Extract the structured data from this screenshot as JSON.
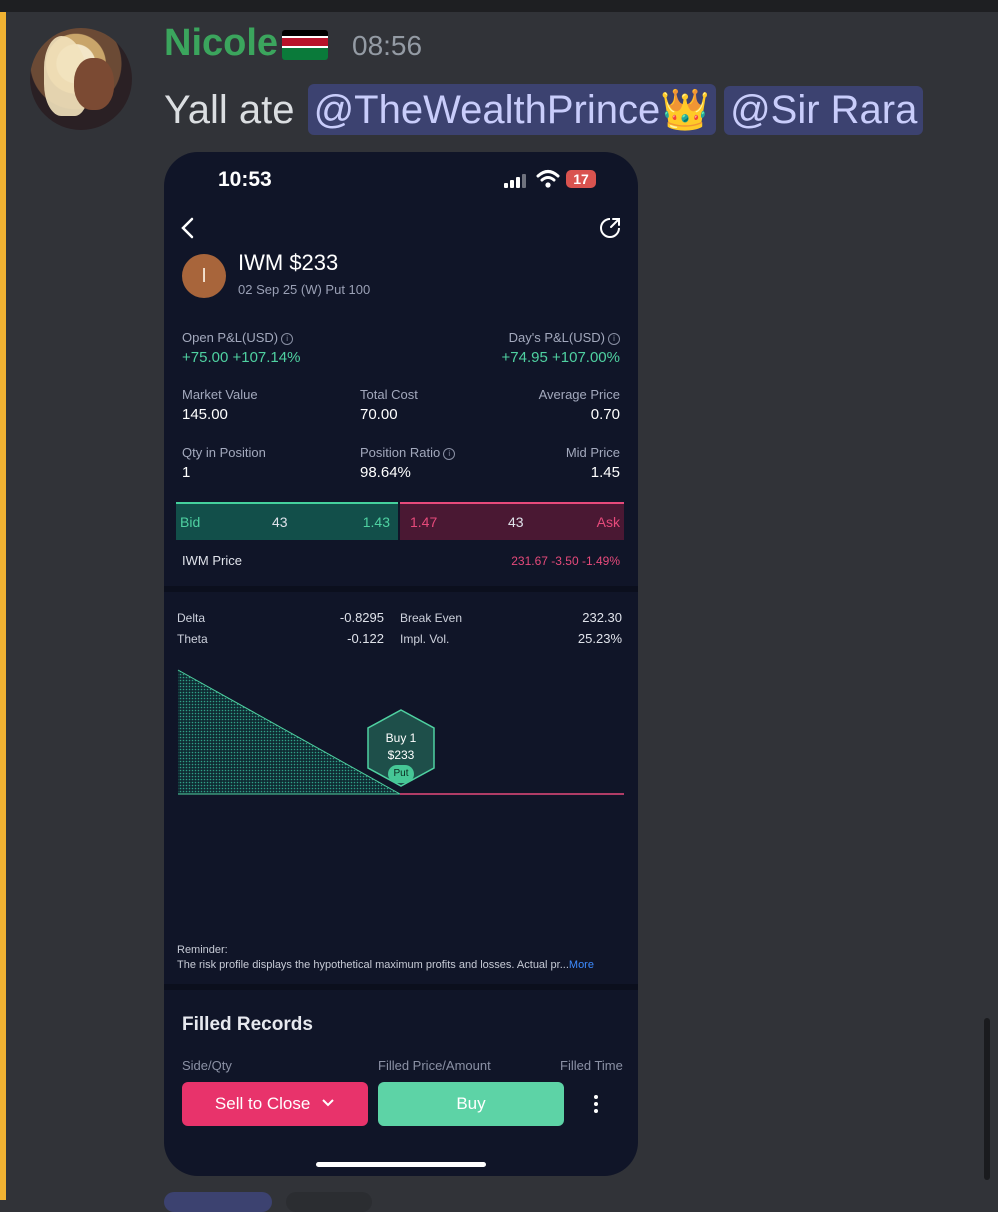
{
  "message": {
    "username": "Nicole",
    "timestamp": "08:56",
    "text": "Yall ate",
    "mentions": [
      "@TheWealthPrince👑",
      "@Sir Rara"
    ],
    "colors": {
      "username": "#3ba55d",
      "mention_bg": "#3c4270",
      "accent": "#f0b232"
    }
  },
  "phone": {
    "status_time": "10:53",
    "battery": "17",
    "badge_letter": "I",
    "title": "IWM $233",
    "subtitle": "02 Sep 25 (W) Put 100",
    "open_pl_label": "Open P&L(USD)",
    "open_pl_value": "+75.00 +107.14%",
    "day_pl_label": "Day's P&L(USD)",
    "day_pl_value": "+74.95 +107.00%",
    "market_value_label": "Market Value",
    "market_value": "145.00",
    "total_cost_label": "Total Cost",
    "total_cost": "70.00",
    "avg_price_label": "Average Price",
    "avg_price": "0.70",
    "qty_label": "Qty in Position",
    "qty": "1",
    "pos_ratio_label": "Position Ratio",
    "pos_ratio": "98.64%",
    "mid_price_label": "Mid Price",
    "mid_price": "1.45",
    "bid_label": "Bid",
    "bid_size": "43",
    "bid_price": "1.43",
    "ask_price": "1.47",
    "ask_size": "43",
    "ask_label": "Ask",
    "iwm_price_label": "IWM Price",
    "iwm_price_value": "231.67 -3.50 -1.49%",
    "delta_label": "Delta",
    "delta": "-0.8295",
    "theta_label": "Theta",
    "theta": "-0.122",
    "break_even_label": "Break Even",
    "break_even": "232.30",
    "impl_vol_label": "Impl. Vol.",
    "impl_vol": "25.23%",
    "hex_line1": "Buy 1",
    "hex_line2": "$233",
    "hex_pill": "Put",
    "reminder_title": "Reminder:",
    "reminder_text": "The risk profile displays the hypothetical maximum profits and losses. Actual pr...",
    "reminder_more": "More",
    "filled_records": "Filled Records",
    "col_side": "Side/Qty",
    "col_price": "Filled Price/Amount",
    "col_time": "Filled Time",
    "sell_button": "Sell to Close",
    "buy_button": "Buy",
    "colors": {
      "green": "#4fd1a1",
      "red": "#e64a7b",
      "bg": "#101528"
    }
  }
}
